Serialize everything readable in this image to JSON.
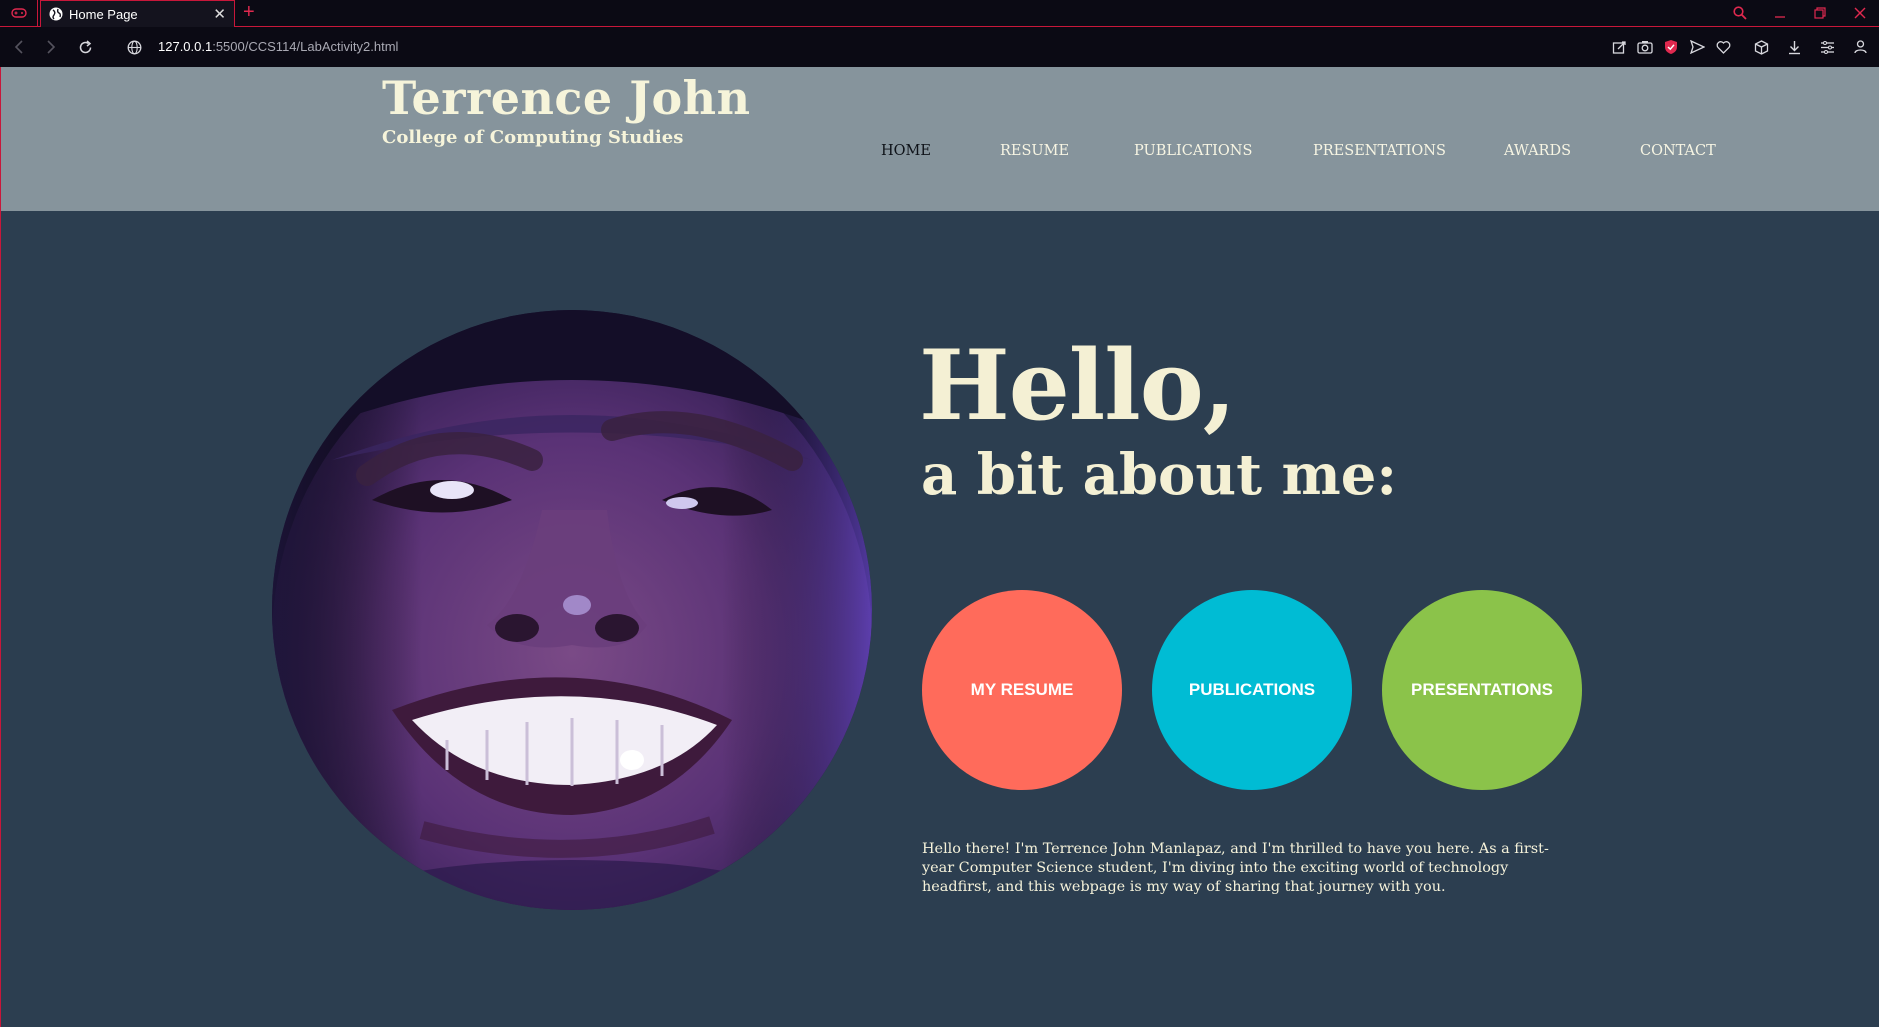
{
  "browser": {
    "tab_title": "Home Page",
    "tab_close": "✕",
    "new_tab": "+",
    "url_host": "127.0.0.1",
    "url_rest": ":5500/CCS114/LabActivity2.html",
    "accent_color": "#c8173a"
  },
  "site": {
    "name": "Terrence John",
    "subtitle": "College of Computing Studies"
  },
  "nav": {
    "items": [
      {
        "label": "HOME",
        "active": true
      },
      {
        "label": "RESUME"
      },
      {
        "label": "PUBLICATIONS"
      },
      {
        "label": "PRESENTATIONS"
      },
      {
        "label": "AWARDS"
      },
      {
        "label": "CONTACT"
      }
    ]
  },
  "hero": {
    "greeting": "Hello,",
    "subheading": "a bit about me:",
    "buttons": [
      {
        "label": "MY RESUME",
        "color": "#ff6b5b"
      },
      {
        "label": "PUBLICATIONS",
        "color": "#00bcd4"
      },
      {
        "label": "PRESENTATIONS",
        "color": "#8bc34a"
      }
    ],
    "intro": "Hello there! I'm Terrence John Manlapaz, and I'm thrilled to have you here. As a first-year Computer Science student, I'm diving into the exciting world of technology headfirst, and this webpage is my way of sharing that journey with you."
  },
  "colors": {
    "header_bg": "#86949c",
    "page_bg": "#2c3e50",
    "heading_text": "#f4f0d4"
  },
  "icons": [
    "gamepad-icon",
    "globe-icon",
    "search-icon",
    "minimize-icon",
    "restore-icon",
    "close-window-icon",
    "back-icon",
    "forward-icon",
    "reload-icon",
    "site-info-icon",
    "snapshot-icon",
    "camera-icon",
    "shield-icon",
    "send-icon",
    "heart-icon",
    "cube-icon",
    "download-icon",
    "menu-icon",
    "profile-icon"
  ]
}
